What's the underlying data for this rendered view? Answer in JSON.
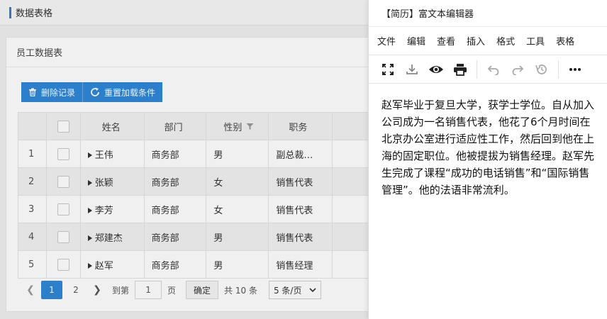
{
  "app": {
    "title": "数据表格"
  },
  "card": {
    "title": "员工数据表"
  },
  "toolbar": {
    "delete_label": "删除记录",
    "reload_label": "重置加载条件"
  },
  "table": {
    "headers": {
      "name": "姓名",
      "department": "部门",
      "gender": "性别",
      "position": "职务"
    },
    "rows": [
      {
        "no": "1",
        "name": "王伟",
        "department": "商务部",
        "gender": "男",
        "position": "副总裁…"
      },
      {
        "no": "2",
        "name": "张颖",
        "department": "商务部",
        "gender": "女",
        "position": "销售代表"
      },
      {
        "no": "3",
        "name": "李芳",
        "department": "商务部",
        "gender": "女",
        "position": "销售代表"
      },
      {
        "no": "4",
        "name": "郑建杰",
        "department": "商务部",
        "gender": "男",
        "position": "销售代表"
      },
      {
        "no": "5",
        "name": "赵军",
        "department": "商务部",
        "gender": "男",
        "position": "销售经理"
      }
    ]
  },
  "pager": {
    "page1": "1",
    "page2": "2",
    "goto_label": "到第",
    "goto_value": "1",
    "page_unit": "页",
    "confirm_label": "确定",
    "total_label": "共 10 条",
    "page_size": "5 条/页"
  },
  "editor": {
    "title": "【简历】富文本编辑器",
    "menu": [
      "文件",
      "编辑",
      "查看",
      "插入",
      "格式",
      "工具",
      "表格"
    ],
    "content": "赵军毕业于复旦大学，获学士学位。自从加入公司成为一名销售代表，他花了6个月时间在北京办公室进行适应性工作，然后回到他在上海的固定职位。他被提拔为销售经理。赵军先生完成了课程“成功的电话销售”和“国际销售管理”。他的法语非常流利。"
  },
  "colors": {
    "accent": "#2f87d8",
    "title_bar": "#3d7ec5"
  }
}
